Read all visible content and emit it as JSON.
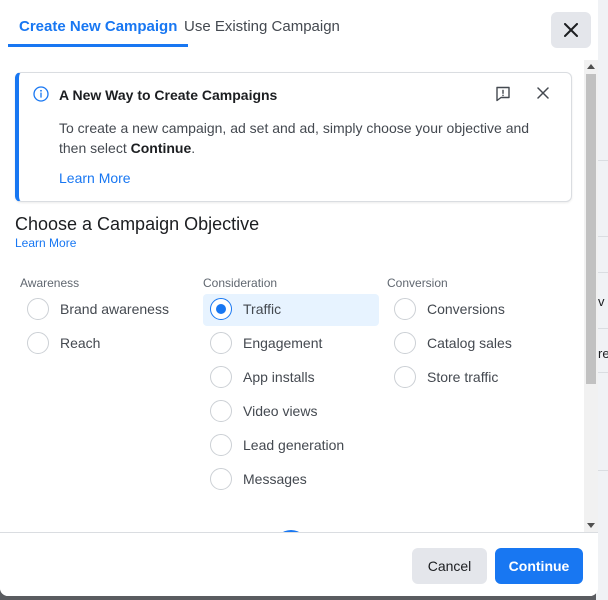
{
  "tabs": [
    {
      "label": "Create New Campaign",
      "active": true
    },
    {
      "label": "Use Existing Campaign",
      "active": false
    }
  ],
  "background": {
    "fragment_1": "v",
    "fragment_2": "re"
  },
  "banner": {
    "title": "A New Way to Create Campaigns",
    "body_prefix": "To create a new campaign, ad set and ad, simply choose your objective and then select ",
    "body_bold": "Continue",
    "body_suffix": ".",
    "link": "Learn More",
    "icons": [
      "info-icon",
      "report-icon",
      "close-icon"
    ]
  },
  "objective": {
    "title": "Choose a Campaign Objective",
    "link": "Learn More",
    "columns": [
      {
        "label": "Awareness",
        "options": [
          "Brand awareness",
          "Reach"
        ]
      },
      {
        "label": "Consideration",
        "options": [
          "Traffic",
          "Engagement",
          "App installs",
          "Video views",
          "Lead generation",
          "Messages"
        ]
      },
      {
        "label": "Conversion",
        "options": [
          "Conversions",
          "Catalog sales",
          "Store traffic"
        ]
      }
    ],
    "selected": "Traffic"
  },
  "footer": {
    "cancel_label": "Cancel",
    "continue_label": "Continue"
  },
  "colors": {
    "accent": "#1877f2",
    "selected_bg": "#e7f3ff"
  }
}
